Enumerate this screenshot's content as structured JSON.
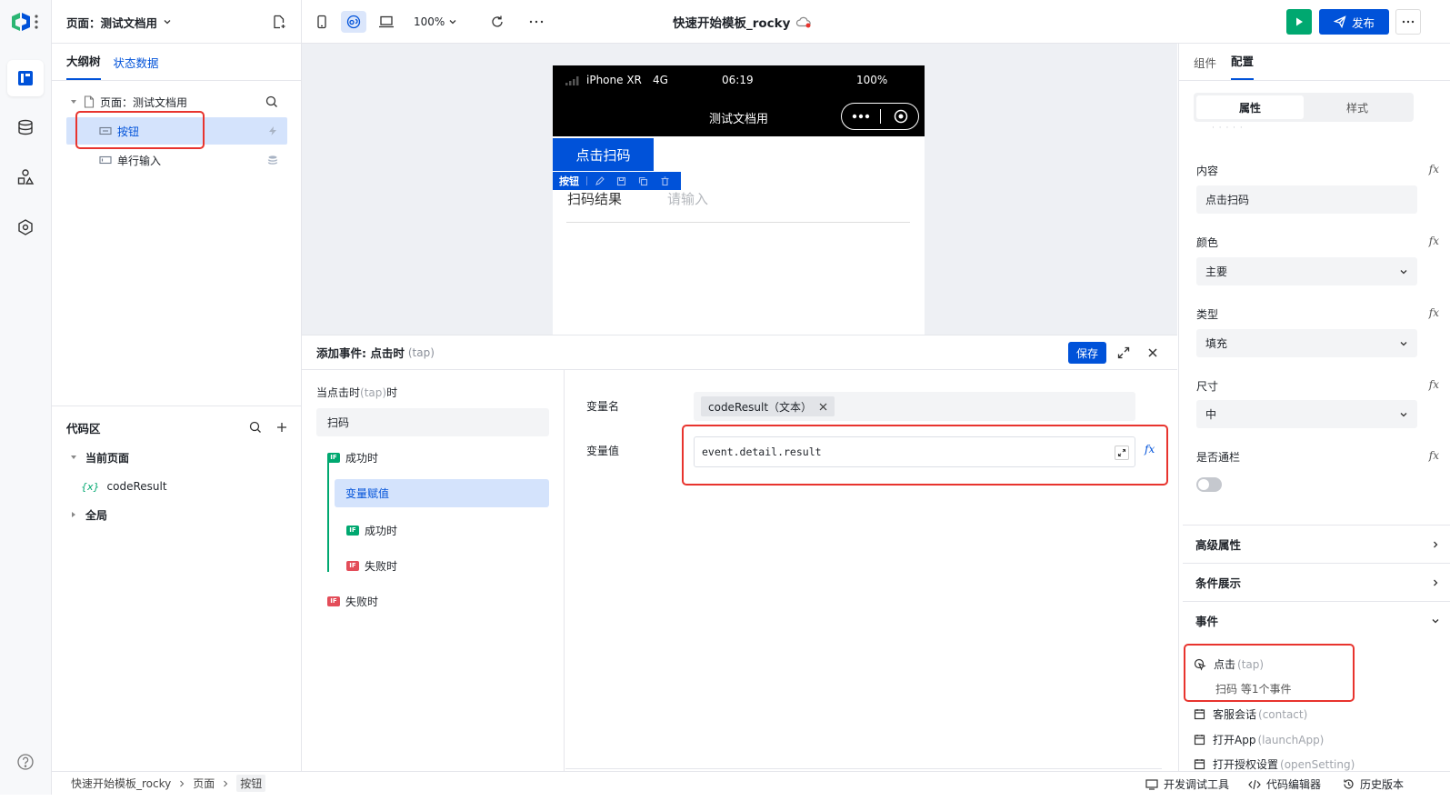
{
  "header": {
    "page_selector": "页面：测试文档用",
    "zoom": "100%",
    "app_title": "快速开始模板_rocky",
    "publish_label": "发布"
  },
  "left_panel": {
    "tabs": [
      "大纲树",
      "状态数据"
    ],
    "tree": {
      "page_label": "页面：测试文档用",
      "items": [
        "按钮",
        "单行输入"
      ]
    },
    "code_area": {
      "title": "代码区",
      "current_page": "当前页面",
      "variable_prefix": "{x}",
      "variable": "codeResult",
      "global": "全局"
    }
  },
  "phone": {
    "device": "iPhone XR",
    "network": "4G",
    "time": "06:19",
    "battery": "100%",
    "nav_title": "测试文档用",
    "scan_button": "点击扫码",
    "selected_tag": "按钮",
    "field_label": "扫码结果",
    "field_placeholder": "请输入"
  },
  "event_editor": {
    "title": "添加事件: 点击时",
    "title_suffix": "(tap)",
    "save_label": "保存",
    "trigger_prefix": "当点击时",
    "trigger_tap": "(tap)",
    "trigger_suffix": "时",
    "action": "扫码",
    "if_tag": "IF",
    "flow": {
      "on_success": "成功时",
      "assign": "变量赋值",
      "nested_success": "成功时",
      "nested_fail": "失败时",
      "on_fail": "失败时"
    },
    "var_name_label": "变量名",
    "var_name_chip": "codeResult（文本）",
    "var_value_label": "变量值",
    "var_value": "event.detail.result"
  },
  "right_panel": {
    "tabs": [
      "组件",
      "配置"
    ],
    "segments": [
      "属性",
      "样式"
    ],
    "dots": "· · · · ·",
    "fx": "fx",
    "props": [
      {
        "label": "内容",
        "value": "点击扫码",
        "dropdown": false
      },
      {
        "label": "颜色",
        "value": "主要",
        "dropdown": true
      },
      {
        "label": "类型",
        "value": "填充",
        "dropdown": true
      },
      {
        "label": "尺寸",
        "value": "中",
        "dropdown": true
      }
    ],
    "full_width_label": "是否通栏",
    "sections": [
      "高级属性",
      "条件展示",
      "事件"
    ],
    "events": {
      "tap_name": "点击",
      "tap_key": "(tap)",
      "tap_summary": "扫码 等1个事件",
      "contact_name": "客服会话",
      "contact_key": "(contact)",
      "launch_name": "打开App",
      "launch_key": "(launchApp)",
      "setting_name": "打开授权设置",
      "setting_key": "(openSetting)"
    }
  },
  "bottombar": {
    "breadcrumb": [
      "快速开始模板_rocky",
      "页面",
      "按钮"
    ],
    "tools": [
      "开发调试工具",
      "代码编辑器",
      "历史版本"
    ]
  },
  "colors": {
    "primary": "#0052d9",
    "selected_bg": "#d4e3fc",
    "red_highlight": "#e8342e",
    "run_green": "#00a870",
    "canvas_bg": "#eef0f4"
  }
}
